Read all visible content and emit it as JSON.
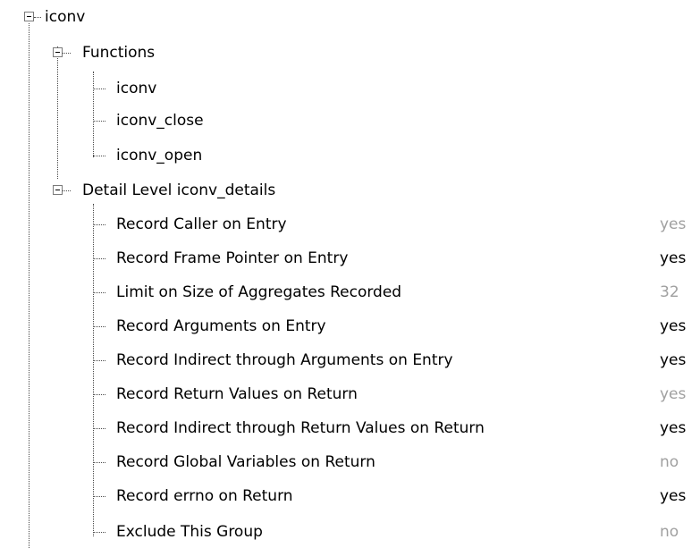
{
  "tree": {
    "root": {
      "label": "iconv",
      "expanded": true
    },
    "functions": {
      "label": "Functions",
      "expanded": true,
      "items": [
        "iconv",
        "iconv_close",
        "iconv_open"
      ]
    },
    "detail": {
      "label": "Detail Level iconv_details",
      "expanded": true,
      "rows": [
        {
          "label": "Record Caller on Entry",
          "value": "yes",
          "style": "muted"
        },
        {
          "label": "Record Frame Pointer on Entry",
          "value": "yes",
          "style": "strong"
        },
        {
          "label": "Limit on Size of Aggregates Recorded",
          "value": "32",
          "style": "muted"
        },
        {
          "label": "Record Arguments on Entry",
          "value": "yes",
          "style": "strong"
        },
        {
          "label": "Record Indirect through Arguments on Entry",
          "value": "yes",
          "style": "strong"
        },
        {
          "label": "Record Return Values on Return",
          "value": "yes",
          "style": "muted"
        },
        {
          "label": "Record Indirect through Return Values on Return",
          "value": "yes",
          "style": "strong"
        },
        {
          "label": "Record Global Variables on Return",
          "value": "no",
          "style": "muted"
        },
        {
          "label": "Record errno on Return",
          "value": "yes",
          "style": "strong"
        },
        {
          "label": "Exclude This Group",
          "value": "no",
          "style": "muted"
        }
      ]
    }
  },
  "colors": {
    "muted_value": "#a0a0a0",
    "strong_value": "#000000",
    "tree_line": "#4a4a4a"
  }
}
